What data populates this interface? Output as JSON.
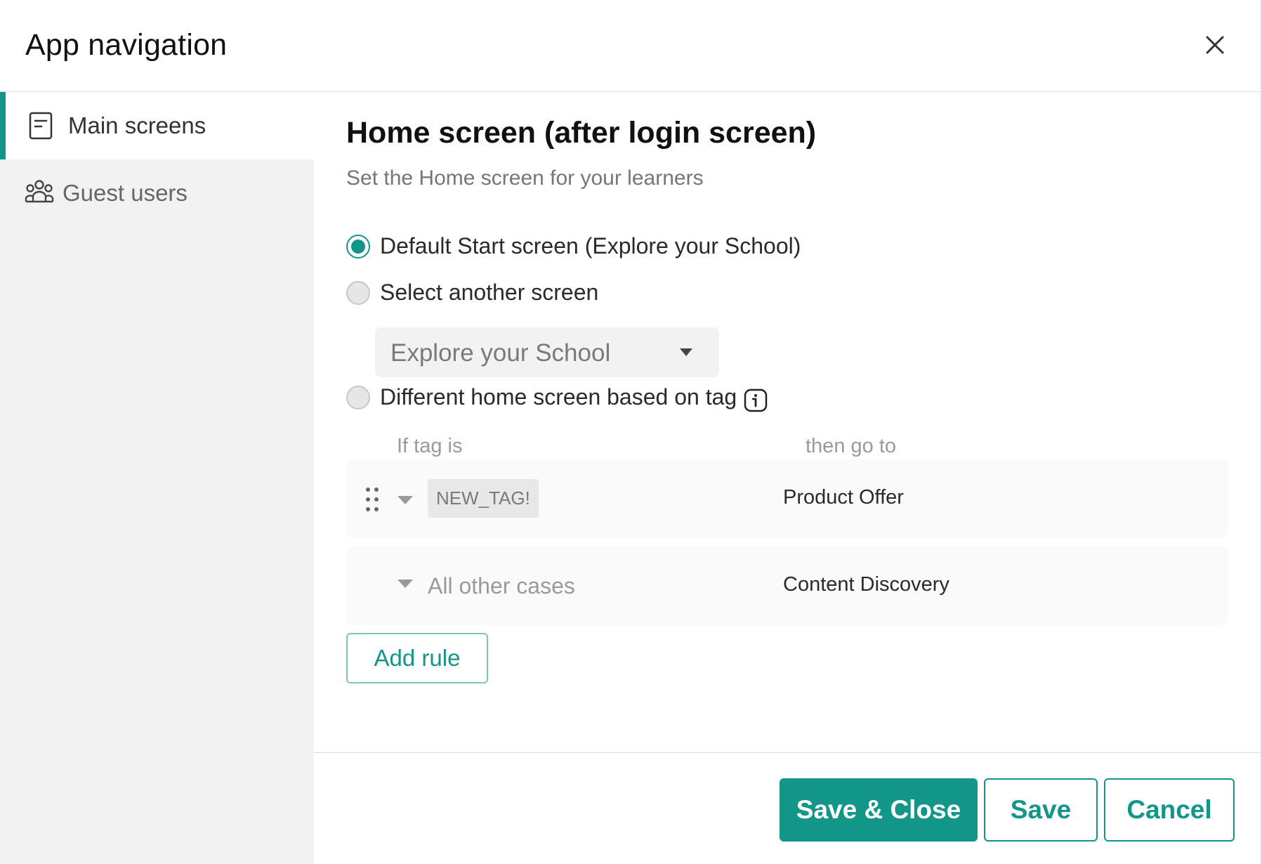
{
  "dialog": {
    "title": "App navigation"
  },
  "sidebar": {
    "items": [
      {
        "label": "Main screens",
        "icon": "document-icon",
        "active": true
      },
      {
        "label": "Guest users",
        "icon": "users-group-icon",
        "active": false
      }
    ]
  },
  "main": {
    "title": "Home screen (after login screen)",
    "subtitle": "Set the Home screen for your learners",
    "options": [
      {
        "label": "Default Start screen (Explore your School)",
        "checked": true
      },
      {
        "label": "Select another screen",
        "checked": false
      },
      {
        "label": "Different home screen based on tag",
        "checked": false
      }
    ],
    "screen_select": {
      "value": "Explore your School"
    },
    "rules_table": {
      "headers": {
        "condition": "If tag is",
        "destination": "then go to"
      },
      "rows": [
        {
          "tag": "NEW_TAG!",
          "destination": "Product Offer"
        },
        {
          "tag": "All other cases",
          "destination": "Content Discovery"
        }
      ]
    },
    "add_rule_label": "Add rule"
  },
  "footer": {
    "save_close_label": "Save & Close",
    "save_label": "Save",
    "cancel_label": "Cancel"
  },
  "colors": {
    "accent": "#13968a",
    "sidebar_bg": "#f2f2f2"
  }
}
